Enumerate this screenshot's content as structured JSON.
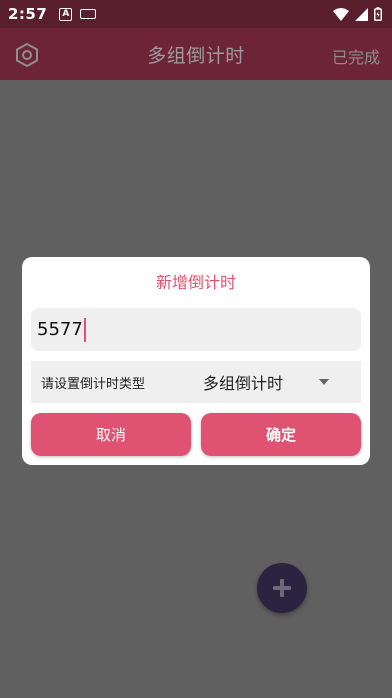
{
  "status_bar": {
    "time": "2:57",
    "icons": [
      "a-icon",
      "keyboard-icon",
      "wifi-icon",
      "signal-icon",
      "battery-icon"
    ]
  },
  "app_bar": {
    "title": "多组倒计时",
    "done_label": "已完成",
    "settings_icon": "hexagon-settings-icon"
  },
  "dialog": {
    "title": "新增倒计时",
    "name_value": "5577",
    "type_label": "请设置倒计时类型",
    "type_selected": "多组倒计时",
    "cancel_label": "取消",
    "confirm_label": "确定"
  },
  "fab": {
    "icon": "plus-icon"
  },
  "colors": {
    "accent": "#e05272",
    "app_bar": "#6e2437",
    "status_bar": "#5a1f2d",
    "scrim": "#606060",
    "fab": "#2a2440"
  }
}
